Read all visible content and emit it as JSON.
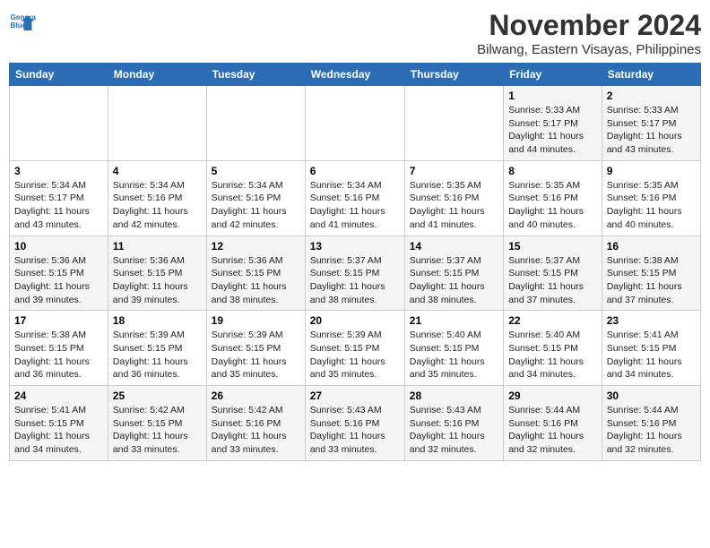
{
  "header": {
    "logo_line1": "General",
    "logo_line2": "Blue",
    "month": "November 2024",
    "location": "Bilwang, Eastern Visayas, Philippines"
  },
  "weekdays": [
    "Sunday",
    "Monday",
    "Tuesday",
    "Wednesday",
    "Thursday",
    "Friday",
    "Saturday"
  ],
  "weeks": [
    [
      {
        "day": "",
        "info": ""
      },
      {
        "day": "",
        "info": ""
      },
      {
        "day": "",
        "info": ""
      },
      {
        "day": "",
        "info": ""
      },
      {
        "day": "",
        "info": ""
      },
      {
        "day": "1",
        "info": "Sunrise: 5:33 AM\nSunset: 5:17 PM\nDaylight: 11 hours\nand 44 minutes."
      },
      {
        "day": "2",
        "info": "Sunrise: 5:33 AM\nSunset: 5:17 PM\nDaylight: 11 hours\nand 43 minutes."
      }
    ],
    [
      {
        "day": "3",
        "info": "Sunrise: 5:34 AM\nSunset: 5:17 PM\nDaylight: 11 hours\nand 43 minutes."
      },
      {
        "day": "4",
        "info": "Sunrise: 5:34 AM\nSunset: 5:16 PM\nDaylight: 11 hours\nand 42 minutes."
      },
      {
        "day": "5",
        "info": "Sunrise: 5:34 AM\nSunset: 5:16 PM\nDaylight: 11 hours\nand 42 minutes."
      },
      {
        "day": "6",
        "info": "Sunrise: 5:34 AM\nSunset: 5:16 PM\nDaylight: 11 hours\nand 41 minutes."
      },
      {
        "day": "7",
        "info": "Sunrise: 5:35 AM\nSunset: 5:16 PM\nDaylight: 11 hours\nand 41 minutes."
      },
      {
        "day": "8",
        "info": "Sunrise: 5:35 AM\nSunset: 5:16 PM\nDaylight: 11 hours\nand 40 minutes."
      },
      {
        "day": "9",
        "info": "Sunrise: 5:35 AM\nSunset: 5:16 PM\nDaylight: 11 hours\nand 40 minutes."
      }
    ],
    [
      {
        "day": "10",
        "info": "Sunrise: 5:36 AM\nSunset: 5:15 PM\nDaylight: 11 hours\nand 39 minutes."
      },
      {
        "day": "11",
        "info": "Sunrise: 5:36 AM\nSunset: 5:15 PM\nDaylight: 11 hours\nand 39 minutes."
      },
      {
        "day": "12",
        "info": "Sunrise: 5:36 AM\nSunset: 5:15 PM\nDaylight: 11 hours\nand 38 minutes."
      },
      {
        "day": "13",
        "info": "Sunrise: 5:37 AM\nSunset: 5:15 PM\nDaylight: 11 hours\nand 38 minutes."
      },
      {
        "day": "14",
        "info": "Sunrise: 5:37 AM\nSunset: 5:15 PM\nDaylight: 11 hours\nand 38 minutes."
      },
      {
        "day": "15",
        "info": "Sunrise: 5:37 AM\nSunset: 5:15 PM\nDaylight: 11 hours\nand 37 minutes."
      },
      {
        "day": "16",
        "info": "Sunrise: 5:38 AM\nSunset: 5:15 PM\nDaylight: 11 hours\nand 37 minutes."
      }
    ],
    [
      {
        "day": "17",
        "info": "Sunrise: 5:38 AM\nSunset: 5:15 PM\nDaylight: 11 hours\nand 36 minutes."
      },
      {
        "day": "18",
        "info": "Sunrise: 5:39 AM\nSunset: 5:15 PM\nDaylight: 11 hours\nand 36 minutes."
      },
      {
        "day": "19",
        "info": "Sunrise: 5:39 AM\nSunset: 5:15 PM\nDaylight: 11 hours\nand 35 minutes."
      },
      {
        "day": "20",
        "info": "Sunrise: 5:39 AM\nSunset: 5:15 PM\nDaylight: 11 hours\nand 35 minutes."
      },
      {
        "day": "21",
        "info": "Sunrise: 5:40 AM\nSunset: 5:15 PM\nDaylight: 11 hours\nand 35 minutes."
      },
      {
        "day": "22",
        "info": "Sunrise: 5:40 AM\nSunset: 5:15 PM\nDaylight: 11 hours\nand 34 minutes."
      },
      {
        "day": "23",
        "info": "Sunrise: 5:41 AM\nSunset: 5:15 PM\nDaylight: 11 hours\nand 34 minutes."
      }
    ],
    [
      {
        "day": "24",
        "info": "Sunrise: 5:41 AM\nSunset: 5:15 PM\nDaylight: 11 hours\nand 34 minutes."
      },
      {
        "day": "25",
        "info": "Sunrise: 5:42 AM\nSunset: 5:15 PM\nDaylight: 11 hours\nand 33 minutes."
      },
      {
        "day": "26",
        "info": "Sunrise: 5:42 AM\nSunset: 5:16 PM\nDaylight: 11 hours\nand 33 minutes."
      },
      {
        "day": "27",
        "info": "Sunrise: 5:43 AM\nSunset: 5:16 PM\nDaylight: 11 hours\nand 33 minutes."
      },
      {
        "day": "28",
        "info": "Sunrise: 5:43 AM\nSunset: 5:16 PM\nDaylight: 11 hours\nand 32 minutes."
      },
      {
        "day": "29",
        "info": "Sunrise: 5:44 AM\nSunset: 5:16 PM\nDaylight: 11 hours\nand 32 minutes."
      },
      {
        "day": "30",
        "info": "Sunrise: 5:44 AM\nSunset: 5:16 PM\nDaylight: 11 hours\nand 32 minutes."
      }
    ]
  ]
}
